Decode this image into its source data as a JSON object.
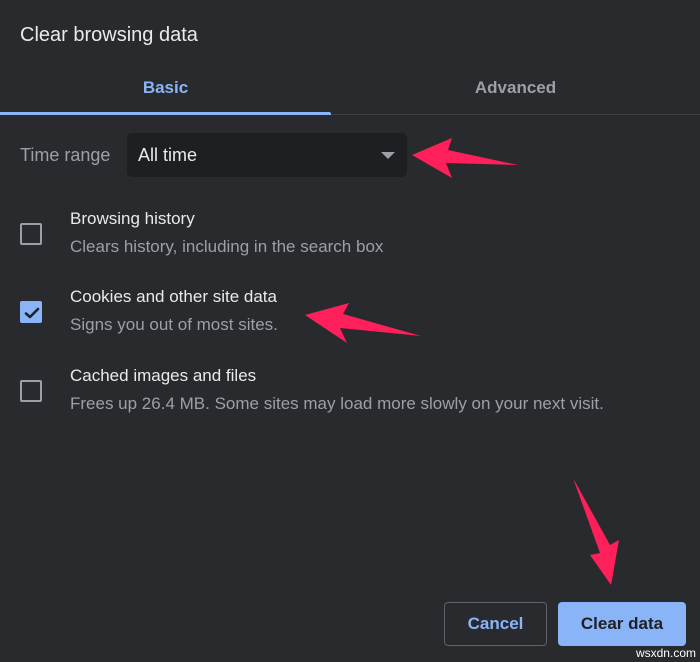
{
  "dialog": {
    "title": "Clear browsing data",
    "tabs": [
      {
        "label": "Basic",
        "active": true
      },
      {
        "label": "Advanced",
        "active": false
      }
    ],
    "time_range": {
      "label": "Time range",
      "selected": "All time"
    },
    "options": [
      {
        "title": "Browsing history",
        "subtitle": "Clears history, including in the search box",
        "checked": false
      },
      {
        "title": "Cookies and other site data",
        "subtitle": "Signs you out of most sites.",
        "checked": true
      },
      {
        "title": "Cached images and files",
        "subtitle": "Frees up 26.4 MB. Some sites may load more slowly on your next visit.",
        "checked": false
      }
    ],
    "buttons": {
      "cancel": "Cancel",
      "clear": "Clear data"
    }
  },
  "annotations": {
    "arrow_color": "#ff1f5a"
  },
  "colors": {
    "accent": "#8ab4f8",
    "background": "#292a2d"
  },
  "watermark": "wsxdn.com"
}
